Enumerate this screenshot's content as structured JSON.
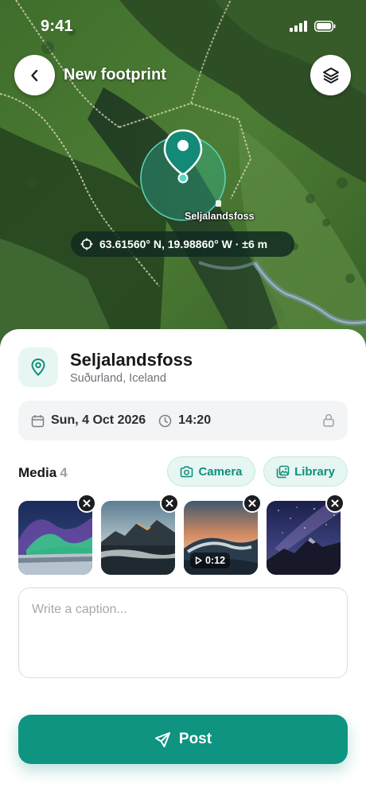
{
  "status_bar": {
    "time": "9:41"
  },
  "header": {
    "title": "New footprint",
    "back_icon": "chevron-left-icon",
    "layers_icon": "layers-icon"
  },
  "map": {
    "place_label": "Seljalandsfoss",
    "coordinates": "63.61560° N, 19.98860° W · ±6 m"
  },
  "location": {
    "name": "Seljalandsfoss",
    "region": "Suðurland, Iceland"
  },
  "datetime": {
    "date": "Sun, 4 Oct 2026",
    "time": "14:20"
  },
  "media": {
    "title": "Media",
    "count": "4",
    "camera_label": "Camera",
    "library_label": "Library",
    "items": [
      {
        "kind": "photo",
        "subject": "aurora"
      },
      {
        "kind": "photo",
        "subject": "coastal-mountain"
      },
      {
        "kind": "video",
        "subject": "wave-sunset",
        "duration": "0:12"
      },
      {
        "kind": "photo",
        "subject": "milky-way-peak"
      }
    ]
  },
  "caption": {
    "placeholder": "Write a caption...",
    "value": ""
  },
  "post": {
    "label": "Post"
  },
  "colors": {
    "accent": "#0f9482",
    "accent_soft": "#e6f6f2",
    "text": "#16181b",
    "muted": "#6e7379"
  }
}
